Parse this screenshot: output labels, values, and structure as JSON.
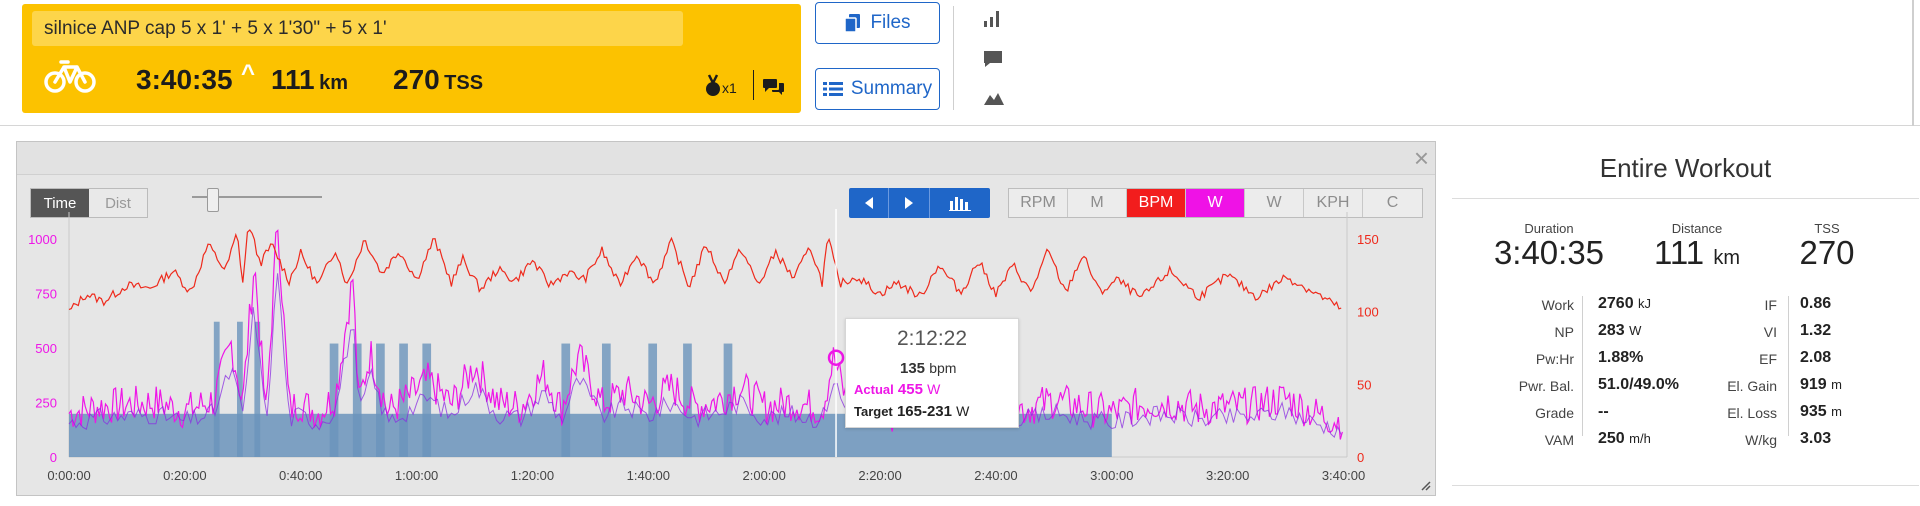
{
  "workout": {
    "title": "silnice ANP cap 5 x 1' + 5 x 1'30\" + 5 x 1'",
    "duration": "3:40:35",
    "caret": "^",
    "distance_value": "111",
    "distance_unit": "km",
    "tss_value": "270",
    "tss_unit": "TSS",
    "medal_count": "x1",
    "card_color": "#fcc200"
  },
  "buttons": {
    "files": "Files",
    "summary": "Summary"
  },
  "side_icons": [
    "bar-chart-icon",
    "comment-icon",
    "map-elevation-icon"
  ],
  "graph": {
    "x_axis_mode": {
      "time": "Time",
      "dist": "Dist"
    },
    "channels": [
      "RPM",
      "M",
      "BPM",
      "W",
      "W",
      "KPH",
      "C"
    ],
    "active_channels": [
      "BPM",
      "W"
    ],
    "left_ticks": [
      "1000",
      "750",
      "500",
      "250",
      "0"
    ],
    "right_ticks": [
      "150",
      "100",
      "50",
      "0"
    ],
    "x_ticks": [
      "0:00:00",
      "0:20:00",
      "0:40:00",
      "1:00:00",
      "1:20:00",
      "1:40:00",
      "2:00:00",
      "2:20:00",
      "2:40:00",
      "3:00:00",
      "3:20:00",
      "3:40:00"
    ],
    "colors": {
      "heart_rate": "#ee2a1c",
      "power": "#ee16e7",
      "target": "#6a93bb",
      "cursor": "#ffffff"
    },
    "tooltip": {
      "time": "2:12:22",
      "hr_value": "135",
      "hr_unit": "bpm",
      "actual_label": "Actual",
      "actual_value": "455",
      "actual_unit": "W",
      "target_label": "Target",
      "target_value": "165-231",
      "target_unit": "W"
    }
  },
  "chart_data": {
    "type": "line",
    "x_unit": "minutes",
    "xlim": [
      0,
      220.6
    ],
    "y_left": {
      "label": "W",
      "ylim": [
        0,
        1100
      ],
      "ticks": [
        0,
        250,
        500,
        750,
        1000
      ]
    },
    "y_right": {
      "label": "bpm",
      "ylim": [
        0,
        165
      ],
      "ticks": [
        0,
        50,
        100,
        150
      ]
    },
    "legend": "none",
    "grid": false,
    "cursor_time": "2:12:22",
    "series": [
      {
        "name": "BPM",
        "axis": "right",
        "x": [
          0,
          3,
          6,
          10,
          14,
          18,
          21,
          24,
          27,
          29,
          30,
          31,
          33,
          35,
          38,
          40,
          43,
          46,
          48,
          51,
          54,
          57,
          60,
          63,
          66,
          68,
          71,
          74,
          77,
          80,
          83,
          86,
          89,
          92,
          95,
          98,
          101,
          104,
          107,
          110,
          113,
          116,
          119,
          122,
          125,
          128,
          130,
          131,
          133,
          136,
          140,
          143,
          147,
          150,
          154,
          157,
          160,
          163,
          166,
          169,
          172,
          175,
          178,
          181,
          185,
          190,
          195,
          200,
          205,
          210,
          215,
          220
        ],
        "y": [
          100,
          112,
          107,
          118,
          116,
          128,
          113,
          146,
          128,
          154,
          120,
          161,
          133,
          146,
          121,
          140,
          118,
          143,
          118,
          150,
          126,
          142,
          122,
          150,
          120,
          136,
          115,
          129,
          121,
          135,
          118,
          127,
          122,
          142,
          118,
          140,
          119,
          148,
          117,
          146,
          120,
          143,
          118,
          141,
          123,
          144,
          120,
          151,
          119,
          124,
          112,
          120,
          110,
          132,
          113,
          135,
          112,
          132,
          113,
          142,
          113,
          139,
          113,
          122,
          109,
          128,
          110,
          125,
          110,
          124,
          113,
          101
        ]
      },
      {
        "name": "W",
        "axis": "left",
        "x": [
          0,
          5,
          10,
          15,
          20,
          25,
          28,
          30,
          32,
          34,
          36,
          38,
          40,
          43,
          46,
          49,
          50,
          52,
          55,
          58,
          62,
          66,
          70,
          74,
          78,
          82,
          85,
          88,
          92,
          96,
          100,
          104,
          108,
          112,
          116,
          120,
          125,
          130,
          132,
          134,
          138,
          142,
          146,
          150,
          155,
          160,
          165,
          170,
          175,
          180,
          185,
          190,
          195,
          200,
          205,
          210,
          215,
          220
        ],
        "y": [
          200,
          230,
          240,
          250,
          210,
          260,
          520,
          250,
          900,
          180,
          1100,
          220,
          250,
          200,
          280,
          820,
          240,
          480,
          210,
          260,
          350,
          240,
          420,
          250,
          230,
          380,
          220,
          460,
          240,
          300,
          240,
          320,
          230,
          260,
          320,
          230,
          250,
          220,
          455,
          280,
          230,
          200,
          250,
          210,
          280,
          260,
          220,
          260,
          230,
          200,
          240,
          250,
          220,
          230,
          240,
          270,
          200,
          160
        ]
      },
      {
        "name": "Target",
        "axis": "left",
        "kind": "steps",
        "segments": [
          {
            "from": 0,
            "to": 180,
            "value": 198
          },
          {
            "from": 25,
            "to": 26,
            "value": 620
          },
          {
            "from": 29,
            "to": 30,
            "value": 620
          },
          {
            "from": 32,
            "to": 33,
            "value": 620
          },
          {
            "from": 45,
            "to": 46.5,
            "value": 520
          },
          {
            "from": 49,
            "to": 50.5,
            "value": 520
          },
          {
            "from": 53,
            "to": 54.5,
            "value": 520
          },
          {
            "from": 57,
            "to": 58.5,
            "value": 520
          },
          {
            "from": 61,
            "to": 62.5,
            "value": 520
          },
          {
            "from": 85,
            "to": 86.5,
            "value": 520
          },
          {
            "from": 92,
            "to": 93.5,
            "value": 520
          },
          {
            "from": 100,
            "to": 101.5,
            "value": 520
          },
          {
            "from": 106,
            "to": 107.5,
            "value": 520
          },
          {
            "from": 113,
            "to": 114.5,
            "value": 520
          }
        ]
      }
    ]
  },
  "summary": {
    "title": "Entire Workout",
    "top": [
      {
        "label": "Duration",
        "value": "3:40:35",
        "unit": ""
      },
      {
        "label": "Distance",
        "value": "111",
        "unit": "km"
      },
      {
        "label": "TSS",
        "value": "270",
        "unit": ""
      }
    ],
    "left": [
      {
        "label": "Work",
        "value": "2760",
        "unit": "kJ"
      },
      {
        "label": "NP",
        "value": "283",
        "unit": "W"
      },
      {
        "label": "Pw:Hr",
        "value": "1.88%",
        "unit": ""
      },
      {
        "label": "Pwr. Bal.",
        "value": "51.0/49.0%",
        "unit": ""
      },
      {
        "label": "Grade",
        "value": "--",
        "unit": ""
      },
      {
        "label": "VAM",
        "value": "250",
        "unit": "m/h"
      }
    ],
    "right": [
      {
        "label": "IF",
        "value": "0.86",
        "unit": ""
      },
      {
        "label": "VI",
        "value": "1.32",
        "unit": ""
      },
      {
        "label": "EF",
        "value": "2.08",
        "unit": ""
      },
      {
        "label": "El. Gain",
        "value": "919",
        "unit": "m"
      },
      {
        "label": "El. Loss",
        "value": "935",
        "unit": "m"
      },
      {
        "label": "W/kg",
        "value": "3.03",
        "unit": ""
      }
    ]
  }
}
